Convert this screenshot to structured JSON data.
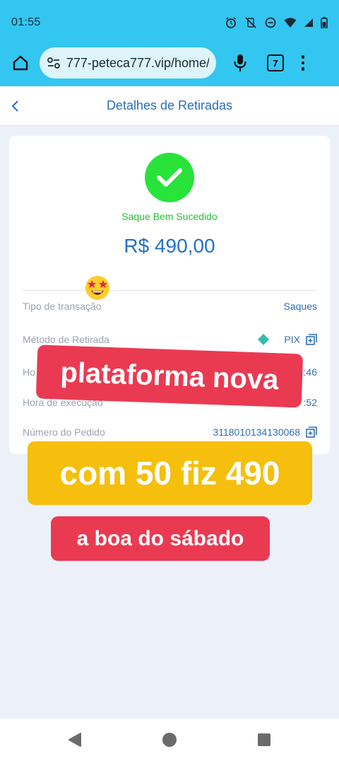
{
  "status_bar": {
    "time": "01:55",
    "icons": [
      "alarm-icon",
      "vibrate-off-icon",
      "dnd-icon",
      "wifi-icon",
      "signal-icon",
      "battery-icon"
    ]
  },
  "browser": {
    "url": "777-peteca777.vip/home/",
    "tab_count": "7"
  },
  "page": {
    "title": "Detalhes de Retiradas"
  },
  "withdrawal": {
    "status": "Saque Bem Sucedido",
    "amount": "R$ 490,00",
    "rows": [
      {
        "label": "Tipo de transação",
        "value": "Saques"
      },
      {
        "label": "Método de Retirada",
        "value": "PIX"
      },
      {
        "label": "Ho",
        "value": ":46"
      },
      {
        "label": "Hora de execução",
        "value": ":52"
      },
      {
        "label": "Número do Pedido",
        "value": "3118010134130068"
      }
    ]
  },
  "overlay": {
    "line1": "plataforma nova",
    "line2": "com 50 fiz 490",
    "line3": "a boa do sábado",
    "emoji": "star-struck-emoji"
  },
  "colors": {
    "chrome": "#33c6f0",
    "accent_blue": "#2272c9",
    "success_green": "#28e33a",
    "pix_teal": "#32bcad",
    "sticker_red": "#ea3a52",
    "sticker_yellow": "#f6bf0e"
  }
}
